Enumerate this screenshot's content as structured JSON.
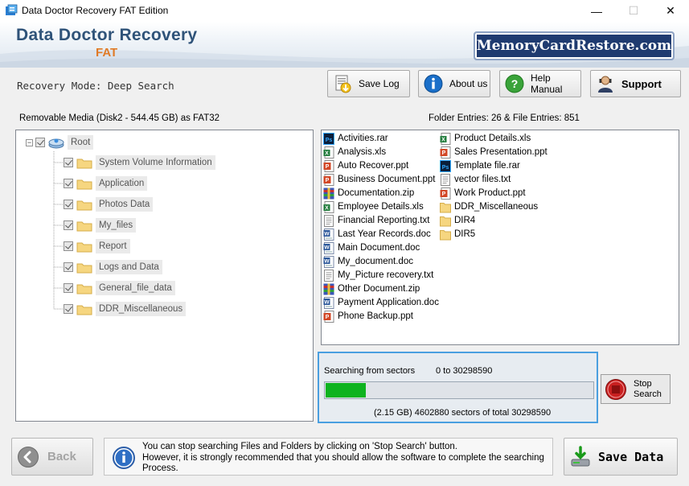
{
  "window": {
    "title": "Data Doctor Recovery FAT Edition",
    "minimize_glyph": "—",
    "maximize_glyph": "☐",
    "close_glyph": "✕"
  },
  "header": {
    "brand_title": "Data Doctor Recovery",
    "brand_subtitle": "FAT",
    "site_badge": "MemoryCardRestore.com",
    "accent_color": "#e07a26",
    "brand_color": "#2f5379"
  },
  "toolbar": {
    "mode": "Recovery Mode: Deep Search",
    "save_log": "Save Log",
    "about": "About us",
    "help": "Help Manual",
    "support": "Support"
  },
  "media": {
    "label": "Removable Media (Disk2 - 544.45 GB) as FAT32",
    "entries": "Folder Entries: 26 & File Entries: 851"
  },
  "tree": {
    "root": "Root",
    "folders": [
      "System Volume Information",
      "Application",
      "Photos Data",
      "My_files",
      "Report",
      "Logs and Data",
      "General_file_data",
      "DDR_Miscellaneous"
    ]
  },
  "files": {
    "col1": [
      {
        "name": "Activities.rar",
        "icon": "photoshop-icon"
      },
      {
        "name": "Analysis.xls",
        "icon": "excel-icon"
      },
      {
        "name": "Auto Recover.ppt",
        "icon": "powerpoint-icon"
      },
      {
        "name": "Business Document.ppt",
        "icon": "powerpoint-icon"
      },
      {
        "name": "Documentation.zip",
        "icon": "archive-icon"
      },
      {
        "name": "Employee Details.xls",
        "icon": "excel-icon"
      },
      {
        "name": "Financial Reporting.txt",
        "icon": "text-file-icon"
      },
      {
        "name": "Last Year Records.doc",
        "icon": "word-icon"
      },
      {
        "name": "Main Document.doc",
        "icon": "word-icon"
      },
      {
        "name": "My_document.doc",
        "icon": "word-icon"
      },
      {
        "name": "My_Picture recovery.txt",
        "icon": "text-file-icon"
      },
      {
        "name": "Other Document.zip",
        "icon": "archive-icon"
      },
      {
        "name": "Payment Application.doc",
        "icon": "word-icon"
      },
      {
        "name": "Phone Backup.ppt",
        "icon": "powerpoint-icon"
      }
    ],
    "col2": [
      {
        "name": "Product Details.xls",
        "icon": "excel-icon"
      },
      {
        "name": "Sales Presentation.ppt",
        "icon": "powerpoint-icon"
      },
      {
        "name": "Template file.rar",
        "icon": "photoshop-icon"
      },
      {
        "name": "vector files.txt",
        "icon": "text-file-icon"
      },
      {
        "name": "Work Product.ppt",
        "icon": "powerpoint-icon"
      },
      {
        "name": "DDR_Miscellaneous",
        "icon": "folder-icon"
      },
      {
        "name": "DIR4",
        "icon": "folder-icon"
      },
      {
        "name": "DIR5",
        "icon": "folder-icon"
      }
    ]
  },
  "progress": {
    "sectors_label": "Searching from sectors",
    "range": "0  to  30298590",
    "total": "(2.15 GB)  4602880   sectors  of  total  30298590",
    "fraction": 0.152,
    "fill_color": "#0eb31f"
  },
  "stop_button": {
    "line1": "Stop",
    "line2": "Search"
  },
  "bottom": {
    "back": "Back",
    "info_line1": "You can stop searching Files and Folders by clicking on 'Stop Search' button.",
    "info_line2": "However, it is strongly recommended that you should allow the software to complete the searching",
    "info_line3": "Process.",
    "save_data": "Save Data"
  }
}
